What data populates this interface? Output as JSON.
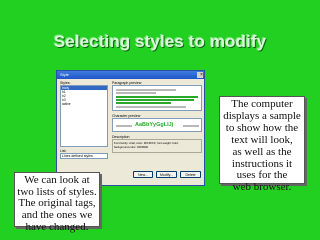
{
  "slide": {
    "title": "Selecting styles to modify"
  },
  "dialog": {
    "window_title": "Style",
    "close_glyph": "×",
    "styles_label": "Styles:",
    "styles": [
      "body",
      "h1",
      "h2",
      "h3",
      "active"
    ],
    "list_label": "List:",
    "list_value": "Lines defined styles",
    "paragraph_preview_label": "Paragraph preview",
    "character_preview_label": "Character preview",
    "character_sample": "AaBbYyGgLlJj",
    "description_label": "Description",
    "description_lines": [
      "Font family: Arial; color: #FFFFFF; font-weight: bold;",
      "background-color: #009900"
    ],
    "buttons": {
      "new": "New...",
      "modify": "Modify...",
      "delete": "Delete"
    }
  },
  "callouts": {
    "right_lines": [
      "The computer",
      "displays a sample",
      "to show how the",
      "text will look,",
      "as well as the",
      "instructions it",
      "uses for the",
      "web browser."
    ],
    "left_lines": [
      "We can look at",
      "two lists of styles.",
      "The original tags,",
      "and the ones we",
      "have changed."
    ]
  }
}
